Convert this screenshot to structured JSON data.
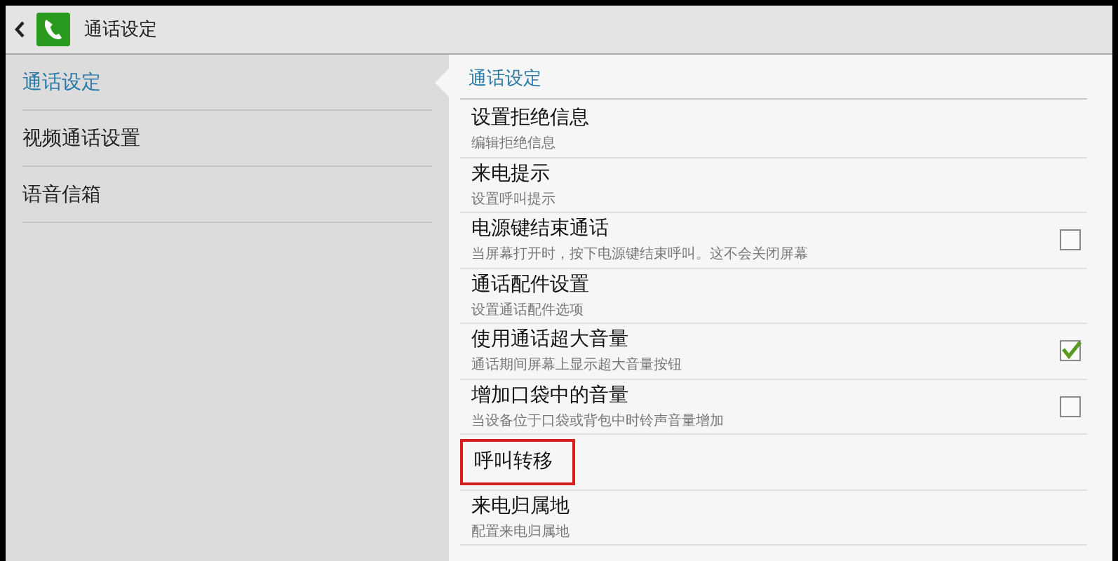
{
  "action_bar": {
    "title": "通话设定"
  },
  "sidebar": {
    "items": [
      {
        "label": "通话设定",
        "selected": true
      },
      {
        "label": "视频通话设置",
        "selected": false
      },
      {
        "label": "语音信箱",
        "selected": false
      }
    ]
  },
  "detail": {
    "header": "通话设定",
    "items": [
      {
        "kind": "link",
        "title": "设置拒绝信息",
        "summary": "编辑拒绝信息",
        "highlighted": false
      },
      {
        "kind": "link",
        "title": "来电提示",
        "summary": "设置呼叫提示",
        "highlighted": false
      },
      {
        "kind": "checkbox",
        "title": "电源键结束通话",
        "summary": "当屏幕打开时，按下电源键结束呼叫。这不会关闭屏幕",
        "checked": false,
        "highlighted": false
      },
      {
        "kind": "link",
        "title": "通话配件设置",
        "summary": "设置通话配件选项",
        "highlighted": false
      },
      {
        "kind": "checkbox",
        "title": "使用通话超大音量",
        "summary": "通话期间屏幕上显示超大音量按钮",
        "checked": true,
        "highlighted": false
      },
      {
        "kind": "checkbox",
        "title": "增加口袋中的音量",
        "summary": "当设备位于口袋或背包中时铃声音量增加",
        "checked": false,
        "highlighted": false
      },
      {
        "kind": "link",
        "title": "呼叫转移",
        "highlighted": true
      },
      {
        "kind": "link",
        "title": "来电归属地",
        "summary": "配置来电归属地",
        "highlighted": false
      }
    ]
  }
}
